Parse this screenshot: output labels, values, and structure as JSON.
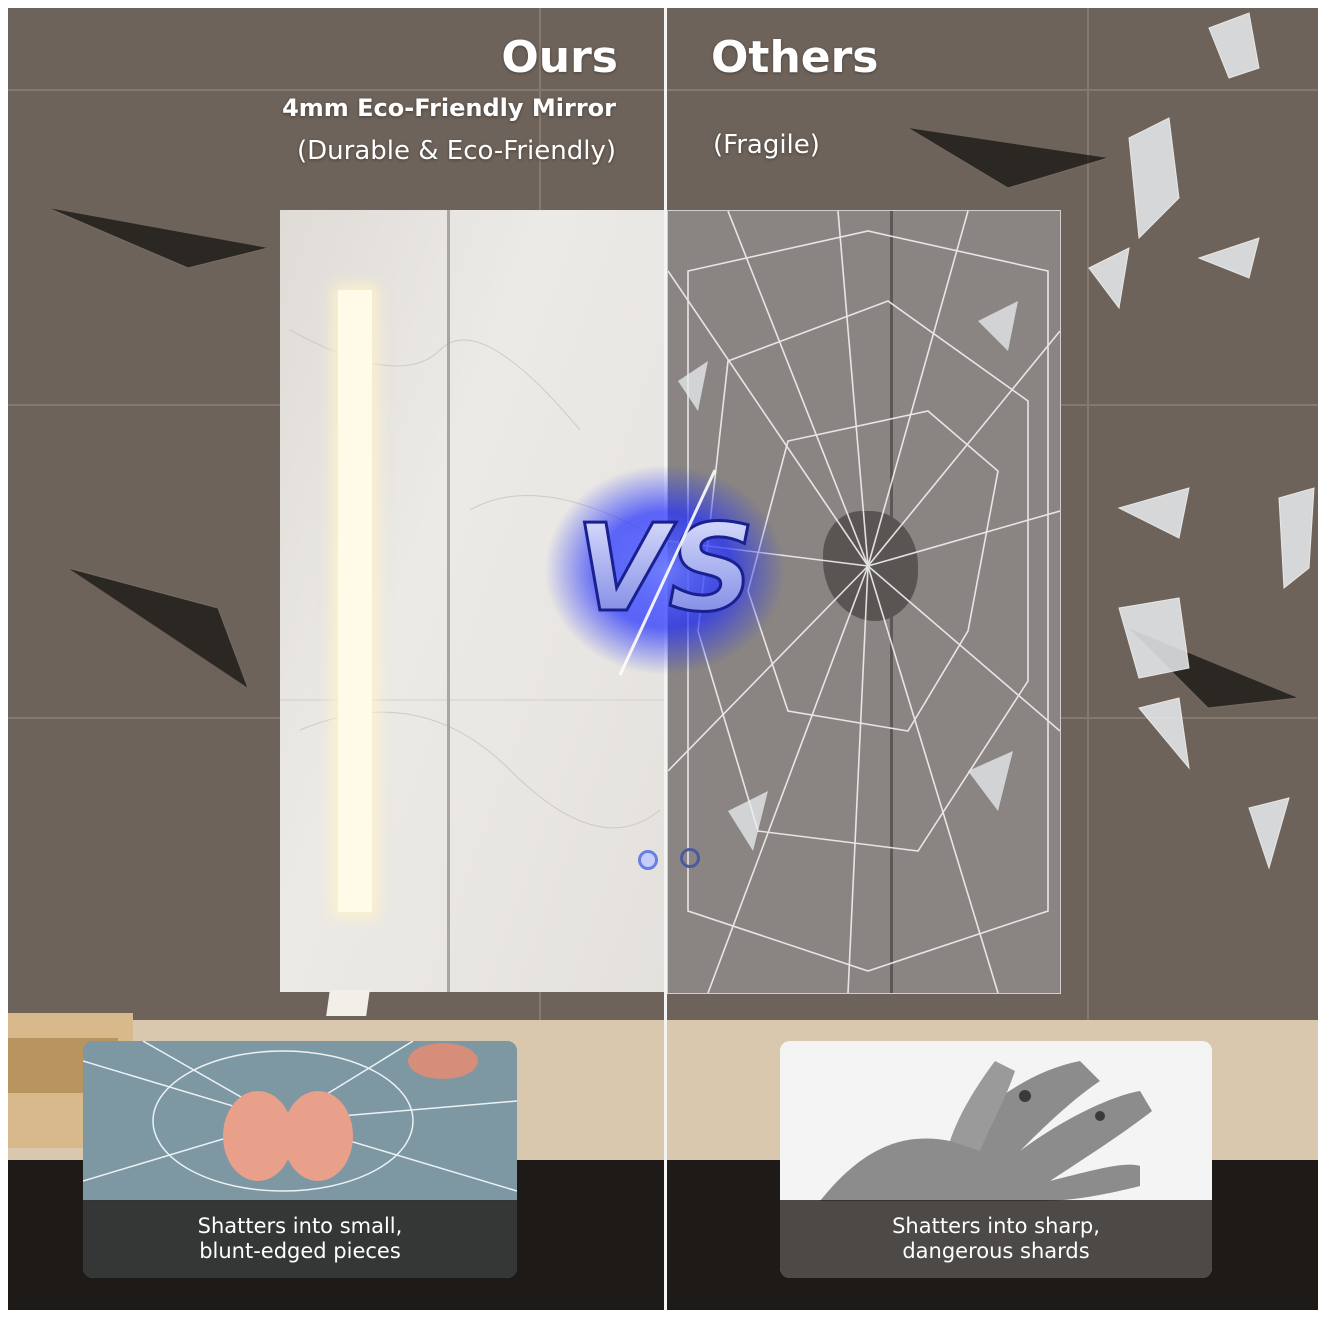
{
  "left": {
    "title": "Ours",
    "subtitle": "4mm Eco-Friendly Mirror",
    "note": "(Durable & Eco-Friendly)",
    "caption": "Shatters into small,\nblunt-edged pieces"
  },
  "right": {
    "title": "Others",
    "note": "(Fragile)",
    "caption": "Shatters into sharp,\ndangerous shards"
  },
  "vs_badge": "VS",
  "colors": {
    "vs_glow": "#1e2cff",
    "led": "#fffbe8",
    "caption_band": "#1c1816"
  }
}
